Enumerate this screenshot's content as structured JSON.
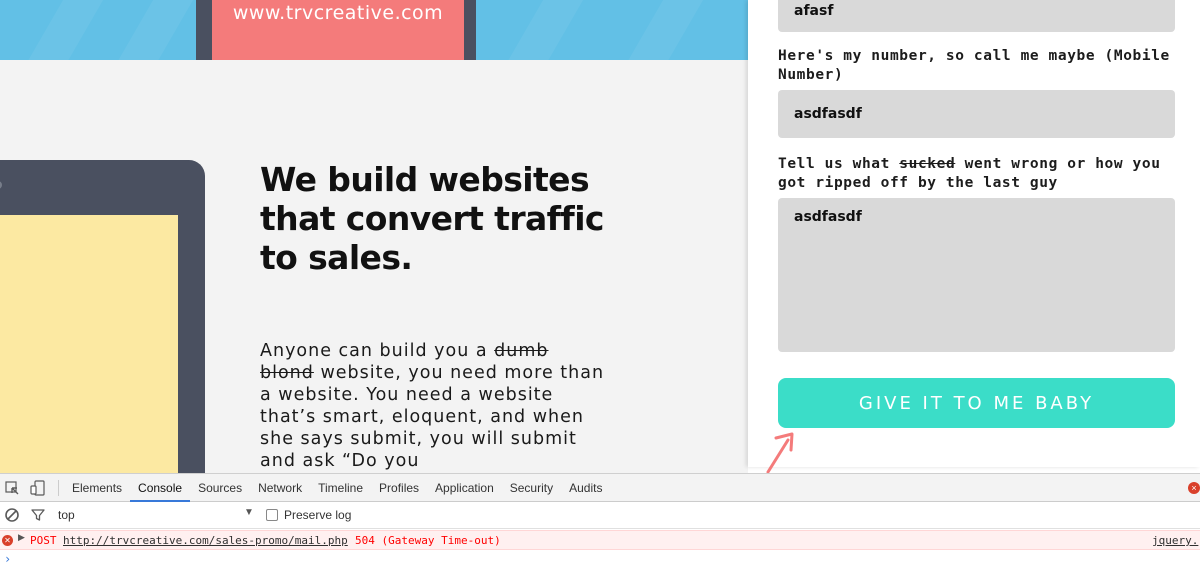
{
  "banner": {
    "site_url": "www.trvcreative.com",
    "colors": {
      "sky": "#62c0e6",
      "device": "#4a5060",
      "screen": "#f47b7b"
    }
  },
  "hero": {
    "headline": "We build websites that convert traffic to sales.",
    "body": {
      "part1": "Anyone can build you a ",
      "strike": "dumb blond",
      "part2": " website, you need more than a website. You need a website that’s smart, eloquent, and when she says submit, you will submit and ask “Do you"
    }
  },
  "form": {
    "top_field_value": "afasf",
    "phone": {
      "label": "Here's my number, so call me maybe (Mobile Number)",
      "value": "asdfasdf"
    },
    "message": {
      "label_before": "Tell us what ",
      "label_strike": "sucked",
      "label_after": " went wrong or how you got ripped off by the last guy",
      "value": "asdfasdf"
    },
    "submit_label": "GIVE IT TO ME BABY",
    "colors": {
      "field_bg": "#d9d9d9",
      "button": "#3bddc8",
      "arrow": "#f47b7b"
    }
  },
  "devtools": {
    "tabs": [
      "Elements",
      "Console",
      "Sources",
      "Network",
      "Timeline",
      "Profiles",
      "Application",
      "Security",
      "Audits"
    ],
    "active_tab": "Console",
    "context": "top",
    "preserve_log_label": "Preserve log",
    "error": {
      "method": "POST",
      "url": "http://trvcreative.com/sales-promo/mail.php",
      "status": "504 (Gateway Time-out)",
      "source": "jquery."
    },
    "colors": {
      "active_tab_underline": "#3879d9",
      "error_text": "#ff0000",
      "error_bg": "#fff0f0"
    }
  }
}
